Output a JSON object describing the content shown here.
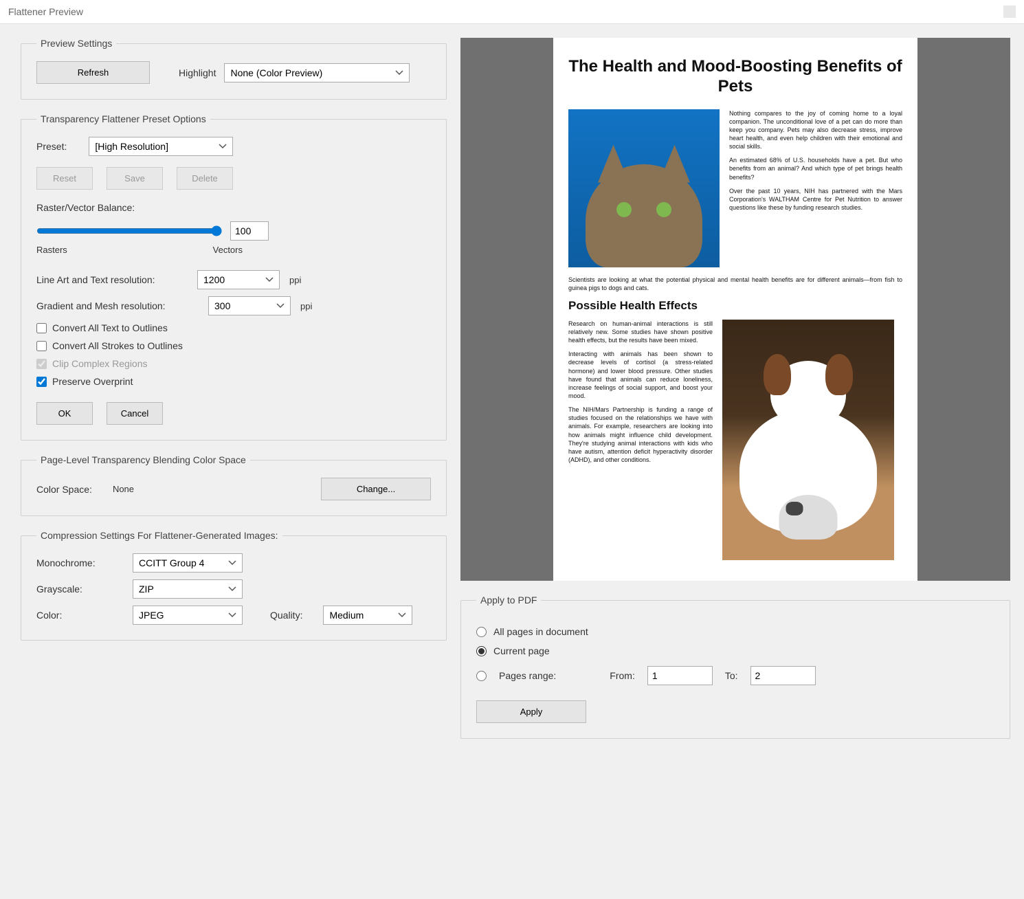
{
  "titlebar": {
    "title": "Flattener Preview"
  },
  "preview_settings": {
    "legend": "Preview Settings",
    "refresh": "Refresh",
    "highlight_label": "Highlight",
    "highlight_value": "None (Color Preview)"
  },
  "transparency": {
    "legend": "Transparency Flattener Preset Options",
    "preset_label": "Preset:",
    "preset_value": "[High Resolution]",
    "reset": "Reset",
    "save": "Save",
    "delete": "Delete",
    "raster_vector_label": "Raster/Vector Balance:",
    "raster_vector_value": "100",
    "rasters_label": "Rasters",
    "vectors_label": "Vectors",
    "lineart_label": "Line Art and Text resolution:",
    "lineart_value": "1200",
    "lineart_unit": "ppi",
    "gradient_label": "Gradient and Mesh resolution:",
    "gradient_value": "300",
    "gradient_unit": "ppi",
    "cb_text_outlines": "Convert All Text to Outlines",
    "cb_strokes_outlines": "Convert All Strokes to Outlines",
    "cb_clip_complex": "Clip Complex Regions",
    "cb_preserve_overprint": "Preserve Overprint",
    "ok": "OK",
    "cancel": "Cancel"
  },
  "color_space": {
    "legend": "Page-Level Transparency Blending Color Space",
    "label": "Color Space:",
    "value": "None",
    "change": "Change..."
  },
  "compression": {
    "legend": "Compression Settings For Flattener-Generated Images:",
    "mono_label": "Monochrome:",
    "mono_value": "CCITT Group 4",
    "gray_label": "Grayscale:",
    "gray_value": "ZIP",
    "color_label": "Color:",
    "color_value": "JPEG",
    "quality_label": "Quality:",
    "quality_value": "Medium"
  },
  "apply": {
    "legend": "Apply to PDF",
    "all_pages": "All pages in document",
    "current_page": "Current page",
    "pages_range": "Pages range:",
    "from_label": "From:",
    "from_value": "1",
    "to_label": "To:",
    "to_value": "2",
    "apply_btn": "Apply"
  },
  "doc": {
    "title": "The Health and Mood-Boosting Benefits of Pets",
    "p1": "Nothing compares to the joy of coming home to a loyal companion. The unconditional love of a pet can do more than keep you company. Pets may also decrease stress, improve heart health, and even help children with their emotional and social skills.",
    "p2": "An estimated 68% of U.S. households have a pet. But who benefits from an animal? And which type of pet brings health benefits?",
    "p3": "Over the past 10 years, NIH has partnered with the Mars Corporation's WALTHAM Centre for Pet Nutrition to answer questions like these by funding research studies.",
    "p4": "Scientists are looking at what the potential physical and mental health benefits are for different animals—from fish to guinea pigs to dogs and cats.",
    "h2": "Possible Health Effects",
    "p5": "Research on human-animal interactions is still relatively new. Some studies have shown positive health effects, but the results have been mixed.",
    "p6": "Interacting with animals has been shown to decrease levels of cortisol (a stress-related hormone) and lower blood pressure. Other studies have found that animals can reduce loneliness, increase feelings of social support, and boost your mood.",
    "p7": "The NIH/Mars Partnership is funding a range of studies focused on the relationships we have with animals. For example, researchers are looking into how animals might influence child development. They're studying animal interactions with kids who have autism, attention deficit hyperactivity disorder (ADHD), and other conditions."
  }
}
